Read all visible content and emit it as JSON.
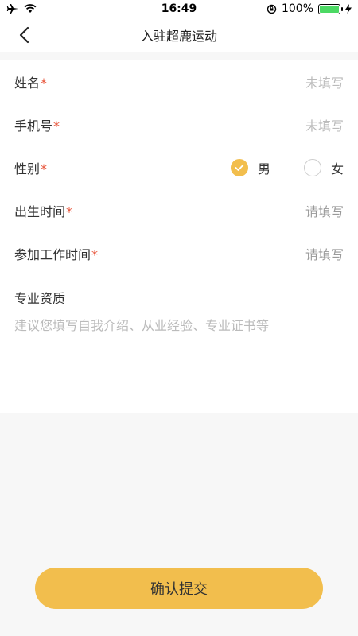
{
  "status_bar": {
    "time": "16:49",
    "battery": "100%"
  },
  "nav": {
    "title": "入驻超鹿运动"
  },
  "form": {
    "name": {
      "label": "姓名",
      "required": "*",
      "value": "未填写"
    },
    "phone": {
      "label": "手机号",
      "required": "*",
      "value": "未填写"
    },
    "gender": {
      "label": "性别",
      "required": "*",
      "options": [
        {
          "label": "男",
          "checked": true
        },
        {
          "label": "女",
          "checked": false
        }
      ]
    },
    "birth": {
      "label": "出生时间",
      "required": "*",
      "value": "请填写"
    },
    "work_start": {
      "label": "参加工作时间",
      "required": "*",
      "value": "请填写"
    },
    "qualification": {
      "label": "专业资质",
      "placeholder": "建议您填写自我介绍、从业经验、专业证书等"
    }
  },
  "submit": {
    "label": "确认提交"
  },
  "colors": {
    "accent": "#f2be4d",
    "required": "#e8543a",
    "placeholder": "#bbbbbb"
  }
}
